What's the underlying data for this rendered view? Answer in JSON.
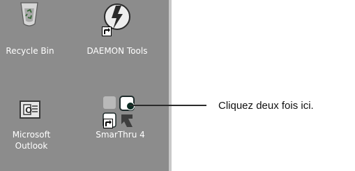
{
  "desktop": {
    "icons": [
      {
        "label": "Recycle Bin",
        "icon": "recycle-bin-icon"
      },
      {
        "label": "DAEMON Tools",
        "icon": "daemon-tools-icon",
        "shortcut": true
      },
      {
        "label_line1": "Microsoft",
        "label_line2": "Outlook",
        "icon": "outlook-icon"
      },
      {
        "label": "SmarThru 4",
        "icon": "smarthru-icon",
        "shortcut": true
      }
    ]
  },
  "callout": {
    "text": "Cliquez deux fois ici."
  },
  "colors": {
    "desktop_bg": "#8c8c8c",
    "label_text": "#ffffff",
    "callout_text": "#111111"
  }
}
